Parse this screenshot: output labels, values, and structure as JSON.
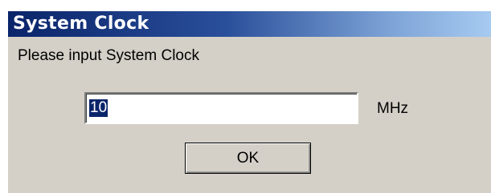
{
  "dialog": {
    "title": "System Clock",
    "prompt": "Please input System Clock",
    "input": {
      "value": "10",
      "selected": true
    },
    "unit": "MHz",
    "ok_label": "OK"
  },
  "colors": {
    "titlebar_start": "#0a246a",
    "titlebar_end": "#a6caf0",
    "dialog_background": "#d4d0c8",
    "selection_background": "#0a246a"
  }
}
